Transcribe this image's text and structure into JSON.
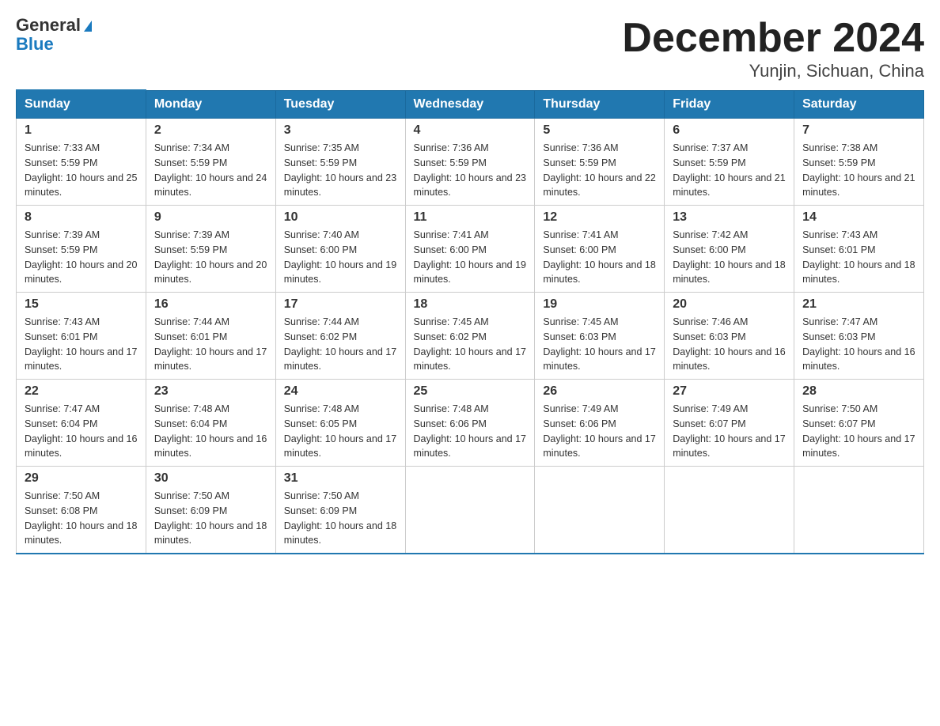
{
  "header": {
    "logo_general": "General",
    "logo_blue": "Blue",
    "month_title": "December 2024",
    "location": "Yunjin, Sichuan, China"
  },
  "days_of_week": [
    "Sunday",
    "Monday",
    "Tuesday",
    "Wednesday",
    "Thursday",
    "Friday",
    "Saturday"
  ],
  "weeks": [
    [
      {
        "day": "1",
        "sunrise": "7:33 AM",
        "sunset": "5:59 PM",
        "daylight": "10 hours and 25 minutes."
      },
      {
        "day": "2",
        "sunrise": "7:34 AM",
        "sunset": "5:59 PM",
        "daylight": "10 hours and 24 minutes."
      },
      {
        "day": "3",
        "sunrise": "7:35 AM",
        "sunset": "5:59 PM",
        "daylight": "10 hours and 23 minutes."
      },
      {
        "day": "4",
        "sunrise": "7:36 AM",
        "sunset": "5:59 PM",
        "daylight": "10 hours and 23 minutes."
      },
      {
        "day": "5",
        "sunrise": "7:36 AM",
        "sunset": "5:59 PM",
        "daylight": "10 hours and 22 minutes."
      },
      {
        "day": "6",
        "sunrise": "7:37 AM",
        "sunset": "5:59 PM",
        "daylight": "10 hours and 21 minutes."
      },
      {
        "day": "7",
        "sunrise": "7:38 AM",
        "sunset": "5:59 PM",
        "daylight": "10 hours and 21 minutes."
      }
    ],
    [
      {
        "day": "8",
        "sunrise": "7:39 AM",
        "sunset": "5:59 PM",
        "daylight": "10 hours and 20 minutes."
      },
      {
        "day": "9",
        "sunrise": "7:39 AM",
        "sunset": "5:59 PM",
        "daylight": "10 hours and 20 minutes."
      },
      {
        "day": "10",
        "sunrise": "7:40 AM",
        "sunset": "6:00 PM",
        "daylight": "10 hours and 19 minutes."
      },
      {
        "day": "11",
        "sunrise": "7:41 AM",
        "sunset": "6:00 PM",
        "daylight": "10 hours and 19 minutes."
      },
      {
        "day": "12",
        "sunrise": "7:41 AM",
        "sunset": "6:00 PM",
        "daylight": "10 hours and 18 minutes."
      },
      {
        "day": "13",
        "sunrise": "7:42 AM",
        "sunset": "6:00 PM",
        "daylight": "10 hours and 18 minutes."
      },
      {
        "day": "14",
        "sunrise": "7:43 AM",
        "sunset": "6:01 PM",
        "daylight": "10 hours and 18 minutes."
      }
    ],
    [
      {
        "day": "15",
        "sunrise": "7:43 AM",
        "sunset": "6:01 PM",
        "daylight": "10 hours and 17 minutes."
      },
      {
        "day": "16",
        "sunrise": "7:44 AM",
        "sunset": "6:01 PM",
        "daylight": "10 hours and 17 minutes."
      },
      {
        "day": "17",
        "sunrise": "7:44 AM",
        "sunset": "6:02 PM",
        "daylight": "10 hours and 17 minutes."
      },
      {
        "day": "18",
        "sunrise": "7:45 AM",
        "sunset": "6:02 PM",
        "daylight": "10 hours and 17 minutes."
      },
      {
        "day": "19",
        "sunrise": "7:45 AM",
        "sunset": "6:03 PM",
        "daylight": "10 hours and 17 minutes."
      },
      {
        "day": "20",
        "sunrise": "7:46 AM",
        "sunset": "6:03 PM",
        "daylight": "10 hours and 16 minutes."
      },
      {
        "day": "21",
        "sunrise": "7:47 AM",
        "sunset": "6:03 PM",
        "daylight": "10 hours and 16 minutes."
      }
    ],
    [
      {
        "day": "22",
        "sunrise": "7:47 AM",
        "sunset": "6:04 PM",
        "daylight": "10 hours and 16 minutes."
      },
      {
        "day": "23",
        "sunrise": "7:48 AM",
        "sunset": "6:04 PM",
        "daylight": "10 hours and 16 minutes."
      },
      {
        "day": "24",
        "sunrise": "7:48 AM",
        "sunset": "6:05 PM",
        "daylight": "10 hours and 17 minutes."
      },
      {
        "day": "25",
        "sunrise": "7:48 AM",
        "sunset": "6:06 PM",
        "daylight": "10 hours and 17 minutes."
      },
      {
        "day": "26",
        "sunrise": "7:49 AM",
        "sunset": "6:06 PM",
        "daylight": "10 hours and 17 minutes."
      },
      {
        "day": "27",
        "sunrise": "7:49 AM",
        "sunset": "6:07 PM",
        "daylight": "10 hours and 17 minutes."
      },
      {
        "day": "28",
        "sunrise": "7:50 AM",
        "sunset": "6:07 PM",
        "daylight": "10 hours and 17 minutes."
      }
    ],
    [
      {
        "day": "29",
        "sunrise": "7:50 AM",
        "sunset": "6:08 PM",
        "daylight": "10 hours and 18 minutes."
      },
      {
        "day": "30",
        "sunrise": "7:50 AM",
        "sunset": "6:09 PM",
        "daylight": "10 hours and 18 minutes."
      },
      {
        "day": "31",
        "sunrise": "7:50 AM",
        "sunset": "6:09 PM",
        "daylight": "10 hours and 18 minutes."
      },
      null,
      null,
      null,
      null
    ]
  ]
}
